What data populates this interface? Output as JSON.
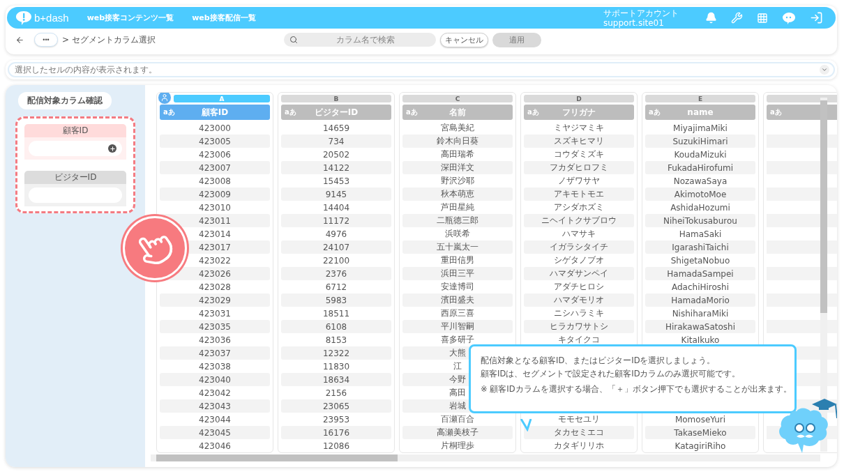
{
  "header": {
    "logo": "b+dash",
    "nav": [
      "web接客コンテンツ一覧",
      "web接客配信一覧"
    ],
    "account_name": "サポートアカウント",
    "account_id": "support.site01"
  },
  "toolbar": {
    "more": "•••",
    "breadcrumb": "> セグメントカラム選択",
    "search": {
      "placeholder": "カラム名で検索"
    },
    "cancel": "キャンセル",
    "apply": {
      "label": "適用",
      "disabled": true
    }
  },
  "cell_preview": {
    "placeholder": "選択したセルの内容が表示されます。"
  },
  "side_panel": {
    "title": "配信対象カラム確認",
    "sections": [
      {
        "label": "顧客ID",
        "active": true
      },
      {
        "label": "ビジターID",
        "active": false
      }
    ]
  },
  "columns": [
    {
      "letter": "A",
      "type": "aあ",
      "title": "顧客ID",
      "selected": true,
      "cells": [
        "423000",
        "423005",
        "423006",
        "423007",
        "423008",
        "423009",
        "423010",
        "423011",
        "423014",
        "423017",
        "423022",
        "423026",
        "423028",
        "423029",
        "423031",
        "423035",
        "423036",
        "423037",
        "423038",
        "423040",
        "423042",
        "423043",
        "423044",
        "423045",
        "423046"
      ]
    },
    {
      "letter": "B",
      "type": "aあ",
      "title": "ビジターID",
      "selected": false,
      "cells": [
        "14659",
        "734",
        "20502",
        "14122",
        "15453",
        "9145",
        "14404",
        "11172",
        "4976",
        "24107",
        "22100",
        "2376",
        "6712",
        "5983",
        "18511",
        "6108",
        "8153",
        "12322",
        "11830",
        "18634",
        "2156",
        "23065",
        "23953",
        "16176",
        "12086"
      ]
    },
    {
      "letter": "C",
      "type": "aあ",
      "title": "名前",
      "selected": false,
      "cells": [
        "宮島美紀",
        "鈴木向日葵",
        "高田瑞希",
        "深田洋文",
        "野沢沙耶",
        "秋本萌恵",
        "芦田星純",
        "二瓶徳三郎",
        "浜咲希",
        "五十嵐太一",
        "重田信男",
        "浜田三平",
        "安達博司",
        "濱田盛夫",
        "西原三喜",
        "平川智嗣",
        "喜多研子",
        "大熊",
        "江",
        "今野",
        "高田",
        "岩城",
        "百瀬百合",
        "高瀬美枝子",
        "片桐理歩"
      ]
    },
    {
      "letter": "D",
      "type": "aあ",
      "title": "フリガナ",
      "selected": false,
      "cells": [
        "ミヤジマミキ",
        "スズキヒマリ",
        "コウダミズキ",
        "フカダヒロフミ",
        "ノザワサヤ",
        "アキモトモエ",
        "アシダホズミ",
        "ニヘイトクサブロウ",
        "ハマサキ",
        "イガラシタイチ",
        "シゲタノブオ",
        "ハマダサンペイ",
        "アダチヒロシ",
        "ハマダモリオ",
        "ニシハラミキ",
        "ヒラカワサトシ",
        "キタイクコ",
        null,
        null,
        null,
        null,
        null,
        "モモセユリ",
        "タカセミエコ",
        "カタギリリホ"
      ]
    },
    {
      "letter": "E",
      "type": "aあ",
      "title": "name",
      "selected": false,
      "cells": [
        "MiyajimaMiki",
        "SuzukiHimari",
        "KoudaMizuki",
        "FukadaHirofumi",
        "NozawaSaya",
        "AkimotoMoe",
        "AshidaHozumi",
        "NiheiTokusaburou",
        "HamaSaki",
        "IgarashiTaichi",
        "ShigetaNobuo",
        "HamadaSampei",
        "AdachiHiroshi",
        "HamadaMorio",
        "NishiharaMiki",
        "HirakawaSatoshi",
        "KitaIkuko",
        null,
        null,
        null,
        null,
        null,
        "MomoseYuri",
        "TakaseMieko",
        "KatagiriRiho"
      ]
    },
    {
      "type": "aあ",
      "selected": false
    }
  ],
  "tooltip": {
    "lines": [
      "配信対象となる顧客ID、またはビジターIDを選択しましょう。",
      "顧客IDは、セグメントで設定された顧客IDカラムのみ選択可能です。"
    ],
    "note": "※ 顧客IDカラムを選択する場合、「＋」ボタン押下でも選択することが出来ます。"
  }
}
